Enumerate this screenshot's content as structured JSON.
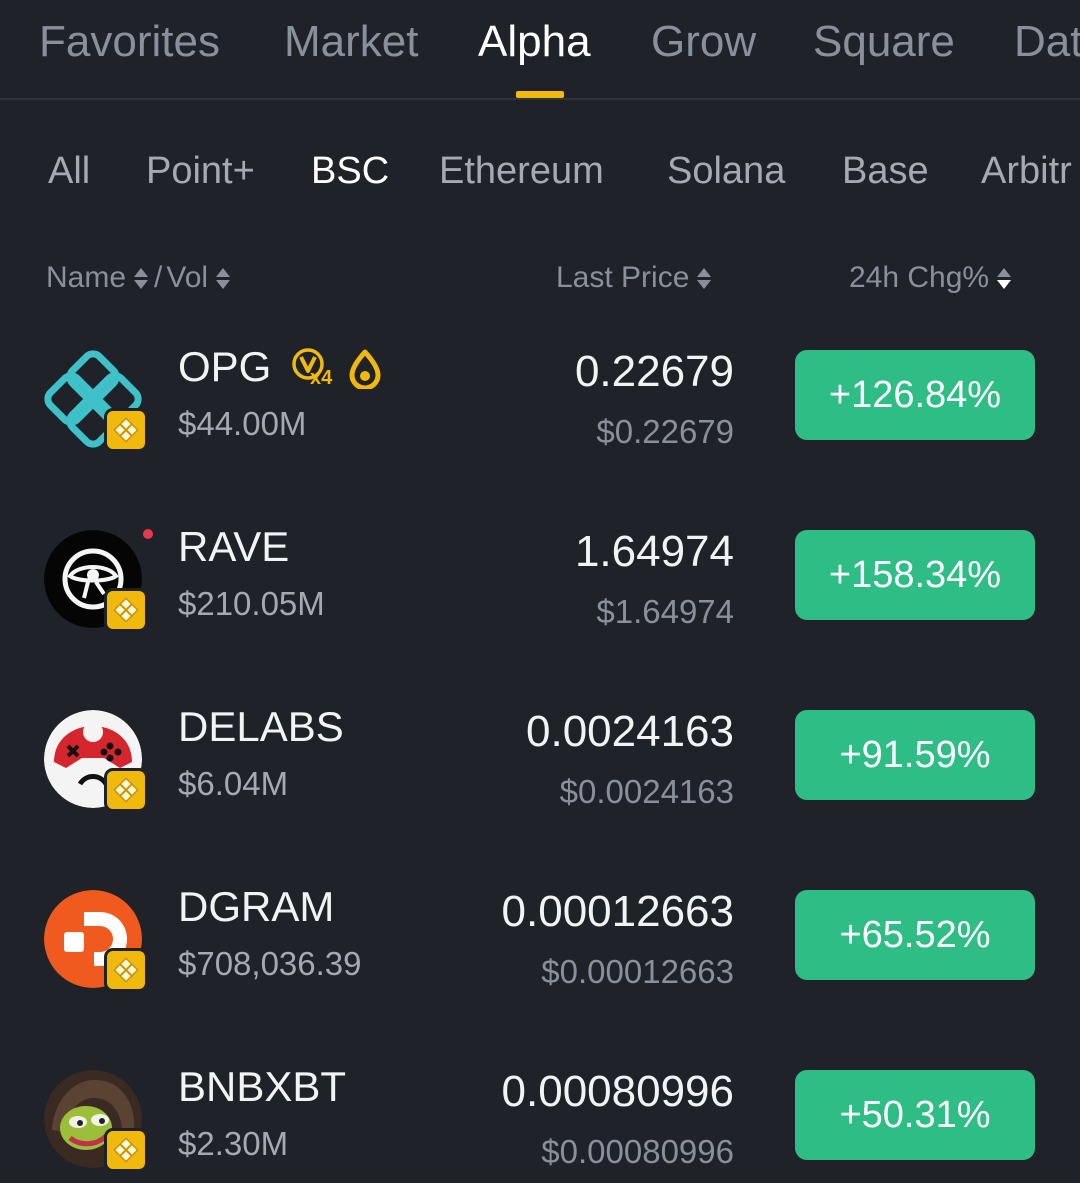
{
  "top_tabs": [
    {
      "label": "Favorites",
      "active": false
    },
    {
      "label": "Market",
      "active": false
    },
    {
      "label": "Alpha",
      "active": true
    },
    {
      "label": "Grow",
      "active": false
    },
    {
      "label": "Square",
      "active": false
    },
    {
      "label": "Dat",
      "active": false
    }
  ],
  "chain_filters": [
    {
      "label": "All",
      "active": false
    },
    {
      "label": "Point+",
      "active": false
    },
    {
      "label": "BSC",
      "active": true
    },
    {
      "label": "Ethereum",
      "active": false
    },
    {
      "label": "Solana",
      "active": false
    },
    {
      "label": "Base",
      "active": false
    },
    {
      "label": "Arbitr",
      "active": false
    }
  ],
  "columns": {
    "name": "Name",
    "sep": "/",
    "vol": "Vol",
    "last_price": "Last Price",
    "change": "24h Chg%"
  },
  "rows": [
    {
      "symbol": "OPG",
      "volume": "$44.00M",
      "price": "0.22679",
      "fiat_price": "$0.22679",
      "change": "+126.84%",
      "multiplier": "x4",
      "icon": "opg-logo"
    },
    {
      "symbol": "RAVE",
      "volume": "$210.05M",
      "price": "1.64974",
      "fiat_price": "$1.64974",
      "change": "+158.34%",
      "icon": "rave-logo"
    },
    {
      "symbol": "DELABS",
      "volume": "$6.04M",
      "price": "0.0024163",
      "fiat_price": "$0.0024163",
      "change": "+91.59%",
      "icon": "delabs-logo"
    },
    {
      "symbol": "DGRAM",
      "volume": "$708,036.39",
      "price": "0.00012663",
      "fiat_price": "$0.00012663",
      "change": "+65.52%",
      "icon": "dgram-logo"
    },
    {
      "symbol": "BNBXBT",
      "volume": "$2.30M",
      "price": "0.00080996",
      "fiat_price": "$0.00080996",
      "change": "+50.31%",
      "icon": "bnbxbt-logo"
    }
  ],
  "colors": {
    "background": "#1f2229",
    "accent": "#f0b90b",
    "positive": "#2ebd85",
    "text_primary": "#f2f3f5",
    "text_secondary": "#8a909b"
  }
}
